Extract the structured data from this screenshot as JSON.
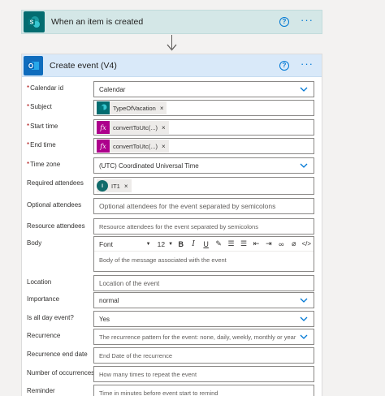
{
  "trigger": {
    "title": "When an item is created",
    "help": "?",
    "more": "···"
  },
  "action": {
    "title": "Create event (V4)",
    "help": "?",
    "more": "···"
  },
  "fields": {
    "calendar_id": {
      "label": "Calendar id",
      "value": "Calendar"
    },
    "subject": {
      "label": "Subject",
      "token": "TypeOfVacation"
    },
    "start_time": {
      "label": "Start time",
      "token": "convertToUtc(...)"
    },
    "end_time": {
      "label": "End time",
      "token": "convertToUtc(...)"
    },
    "time_zone": {
      "label": "Time zone",
      "value": "(UTC) Coordinated Universal Time"
    },
    "required_attendees": {
      "label": "Required attendees",
      "token": "IT1",
      "avatar": "I"
    },
    "optional_attendees": {
      "label": "Optional attendees",
      "placeholder": "Optional attendees for the event separated by semicolons"
    },
    "resource_attendees": {
      "label": "Resource attendees",
      "placeholder": "Resource attendees for the event separated by semicolons"
    },
    "body": {
      "label": "Body",
      "font": "Font",
      "size": "12",
      "placeholder": "Body of the message associated with the event"
    },
    "location": {
      "label": "Location",
      "placeholder": "Location of the event"
    },
    "importance": {
      "label": "Importance",
      "value": "normal"
    },
    "is_all_day": {
      "label": "Is all day event?",
      "value": "Yes"
    },
    "recurrence": {
      "label": "Recurrence",
      "placeholder": "The recurrence pattern for the event: none, daily, weekly, monthly or year"
    },
    "recurrence_end": {
      "label": "Recurrence end date",
      "placeholder": "End Date of the recurrence"
    },
    "occurrences": {
      "label": "Number of occurrences",
      "placeholder": "How many times to repeat the event"
    },
    "reminder": {
      "label": "Reminder",
      "placeholder": "Time in minutes before event start to remind"
    }
  },
  "required_mark": "*",
  "close_glyph": "×",
  "colors": {
    "trigger_bg": "#d4e7e7",
    "action_header_bg": "#d9e9f9",
    "accent": "#0078d4",
    "required": "#a80000",
    "fx_token": "#ad008c",
    "sharepoint": "#036c70"
  }
}
